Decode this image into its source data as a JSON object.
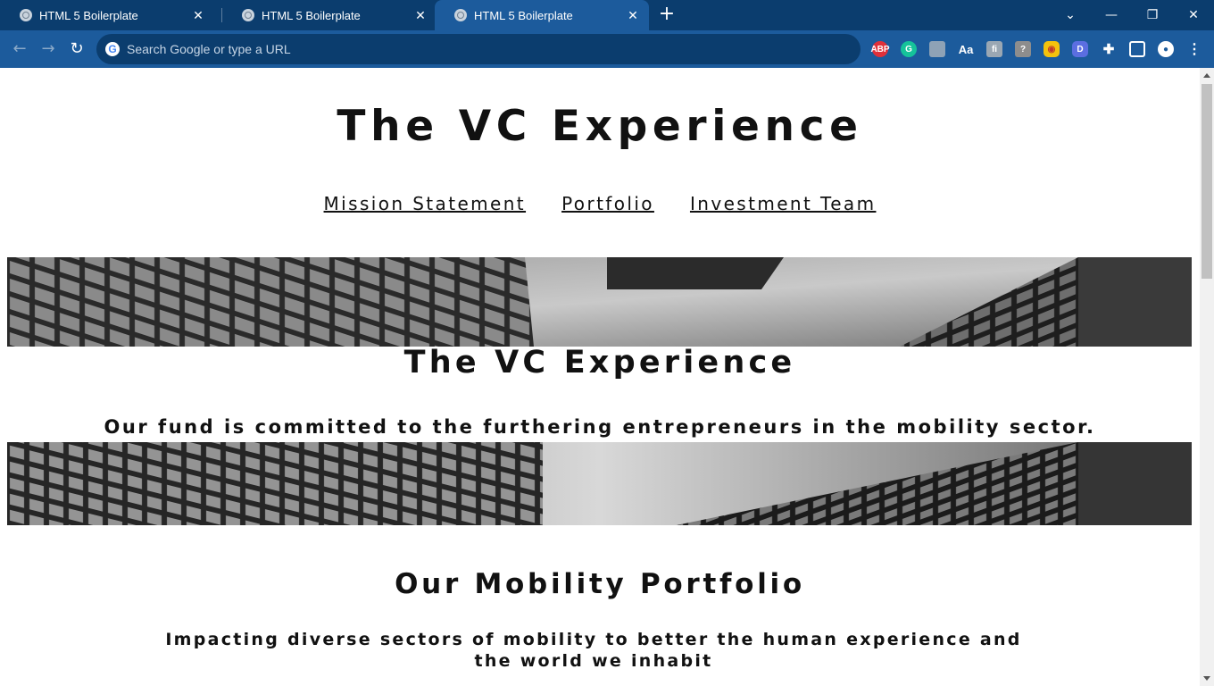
{
  "browser": {
    "tabs": [
      {
        "title": "HTML 5 Boilerplate",
        "active": false
      },
      {
        "title": "HTML 5 Boilerplate",
        "active": false
      },
      {
        "title": "HTML 5 Boilerplate",
        "active": true
      }
    ],
    "omnibox_placeholder": "Search Google or type a URL",
    "extensions": [
      "abp-icon",
      "grammarly-icon",
      "extension-icon",
      "dictionary-icon",
      "extension-icon",
      "help-icon",
      "extension-icon",
      "extension-icon",
      "puzzle-icon",
      "sidepanel-icon",
      "profile-icon",
      "menu-icon"
    ]
  },
  "page": {
    "site_title": "The VC Experience",
    "nav": [
      "Mission Statement",
      "Portfolio",
      "Investment Team"
    ],
    "hero": {
      "title": "The VC Experience",
      "subtitle": "Our fund is committed to the furthering entrepreneurs in the mobility sector."
    },
    "portfolio": {
      "title": "Our Mobility Portfolio",
      "subtitle": "Impacting diverse sectors of mobility to better the human experience and the world we inhabit"
    }
  }
}
